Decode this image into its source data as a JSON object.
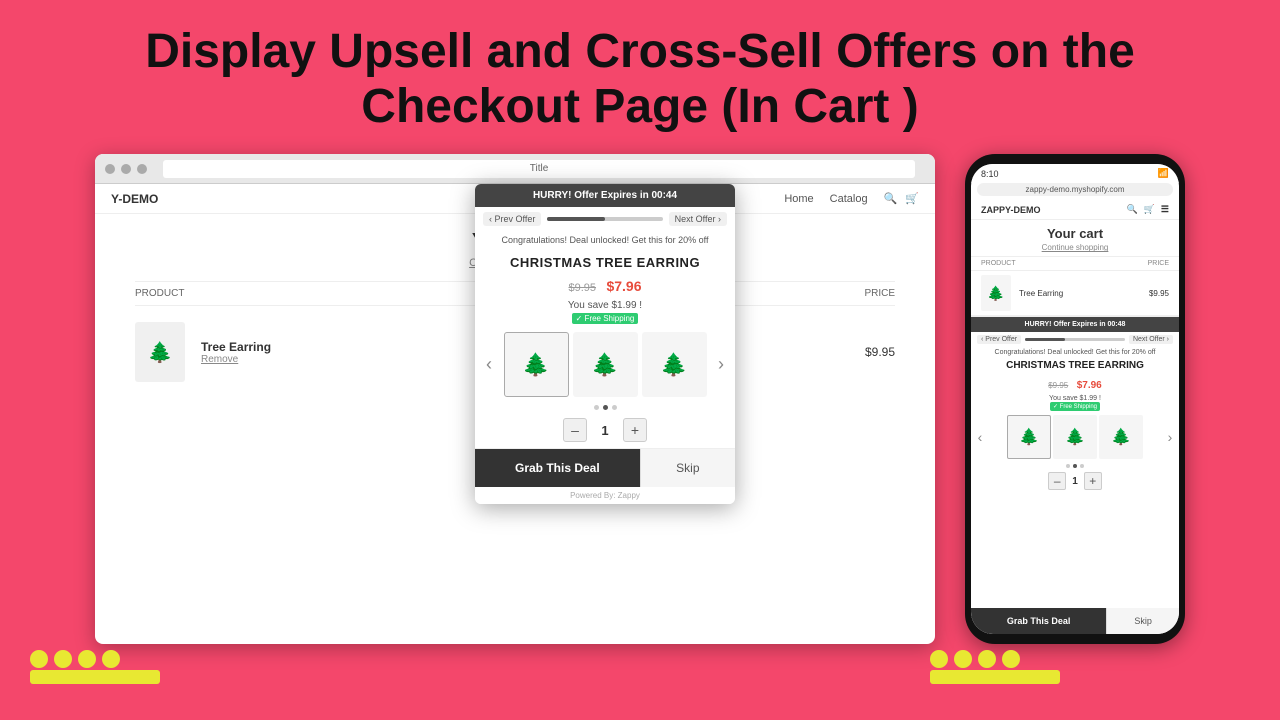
{
  "page": {
    "title": "Display Upsell and Cross-Sell Offers on the Checkout Page (In Cart )",
    "background_color": "#f4476b"
  },
  "browser": {
    "url_text": "Title",
    "shop_logo": "Y-DEMO",
    "nav_links": [
      "Home",
      "Catalog"
    ],
    "cart_title": "Your cart",
    "cart_subtitle": "Continue shopping",
    "table_headers": {
      "product": "PRODUCT",
      "price": "PRICE"
    },
    "cart_item": {
      "name": "Tree Earring",
      "remove_label": "Remove",
      "price": "$9.95",
      "emoji": "🌲"
    }
  },
  "popup": {
    "timer_text": "HURRY! Offer Expires in  00:44",
    "prev_label": "‹ Prev Offer",
    "next_label": "Next Offer ›",
    "deal_text": "Congratulations! Deal unlocked! Get this for 20% off",
    "product_title": "CHRISTMAS TREE EARRING",
    "original_price": "$9.95",
    "sale_price": "$7.96",
    "savings_text": "You save $1.99 !",
    "shipping_badge": "✓ Free Shipping",
    "quantity": "1",
    "qty_minus": "–",
    "qty_plus": "+",
    "grab_btn": "Grab This Deal",
    "skip_btn": "Skip",
    "powered_by": "Powered By: Zappy",
    "carousel_emoji": [
      "🌲",
      "🌲",
      "🌲"
    ]
  },
  "mobile": {
    "time": "8:10",
    "url": "zappy-demo.myshopify.com",
    "shop_logo": "ZAPPY-DEMO",
    "cart_title": "Your cart",
    "cart_subtitle": "Continue shopping",
    "table_headers": {
      "product": "PRODUCT",
      "price": "PRICE"
    },
    "cart_item": {
      "name": "Tree Earring",
      "price": "$9.95",
      "emoji": "🌲"
    },
    "popup": {
      "timer_text": "HURRY! Offer Expires in  00:48",
      "prev_label": "‹ Prev Offer",
      "next_label": "Next Offer ›",
      "deal_text": "Congratulations! Deal unlocked! Get this for 20% off",
      "product_title": "CHRISTMAS TREE EARRING",
      "original_price": "$9.95",
      "sale_price": "$7.96",
      "savings_text": "You save $1.99 !",
      "shipping_badge": "✓ Free Shipping",
      "quantity": "1",
      "qty_minus": "–",
      "qty_plus": "+",
      "grab_btn": "Grab This Deal",
      "skip_btn": "Skip"
    }
  },
  "decorative": {
    "dots_count": 4
  }
}
